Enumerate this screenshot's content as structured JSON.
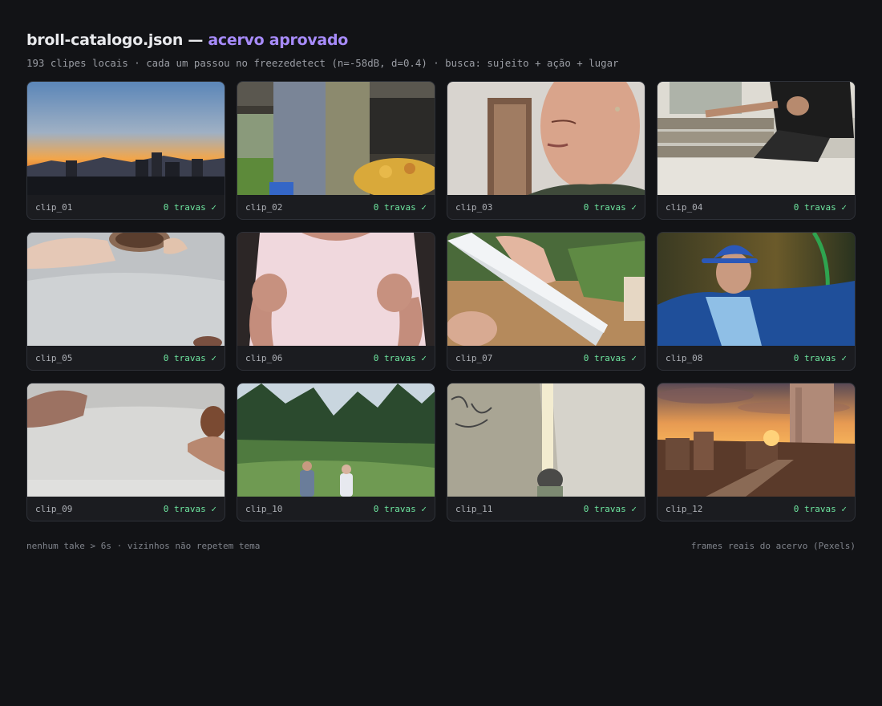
{
  "header": {
    "title_main": "broll-catalogo.json —",
    "title_accent": "acervo aprovado",
    "subtitle": "193 clipes locais · cada um passou no freezedetect (n=-58dB, d=0.4) · busca: sujeito + ação + lugar"
  },
  "clips": [
    {
      "name": "clip_01",
      "status": "0 travas ✓"
    },
    {
      "name": "clip_02",
      "status": "0 travas ✓"
    },
    {
      "name": "clip_03",
      "status": "0 travas ✓"
    },
    {
      "name": "clip_04",
      "status": "0 travas ✓"
    },
    {
      "name": "clip_05",
      "status": "0 travas ✓"
    },
    {
      "name": "clip_06",
      "status": "0 travas ✓"
    },
    {
      "name": "clip_07",
      "status": "0 travas ✓"
    },
    {
      "name": "clip_08",
      "status": "0 travas ✓"
    },
    {
      "name": "clip_09",
      "status": "0 travas ✓"
    },
    {
      "name": "clip_10",
      "status": "0 travas ✓"
    },
    {
      "name": "clip_11",
      "status": "0 travas ✓"
    },
    {
      "name": "clip_12",
      "status": "0 travas ✓"
    }
  ],
  "footer": {
    "left": "nenhum take > 6s · vizinhos não repetem tema",
    "right": "frames reais do acervo (Pexels)"
  },
  "colors": {
    "background": "#121316",
    "accent": "#a78bfa",
    "ok": "#6ee7a0"
  }
}
